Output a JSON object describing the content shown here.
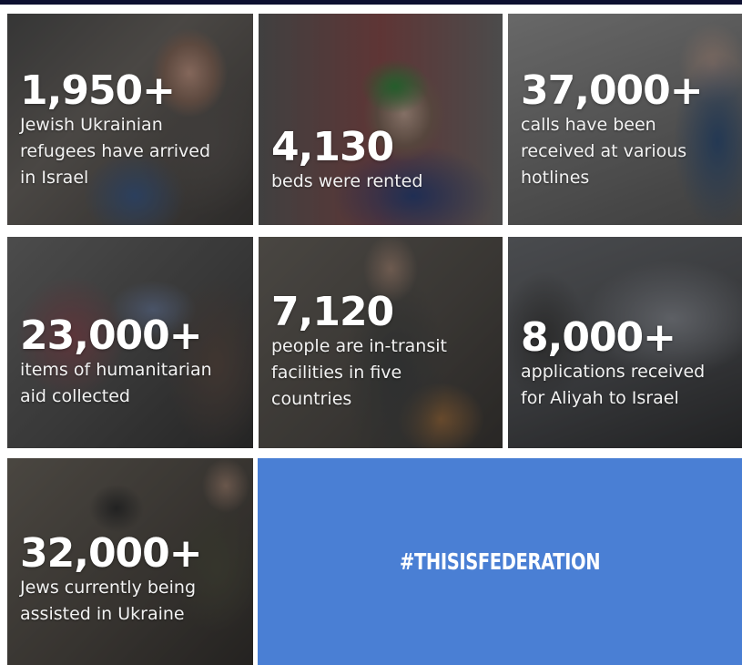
{
  "stats": [
    {
      "number": "1,950+",
      "lines": [
        "Jewish Ukrainian",
        "refugees have arrived",
        "in Israel"
      ]
    },
    {
      "number": "4,130",
      "lines": [
        "beds were rented"
      ]
    },
    {
      "number": "37,000+",
      "lines": [
        "calls have been",
        "received at various",
        "hotlines"
      ]
    },
    {
      "number": "23,000+",
      "lines": [
        "items of humanitarian",
        "aid collected"
      ]
    },
    {
      "number": "7,120",
      "lines": [
        "people are in-transit",
        "facilities in five",
        "countries"
      ]
    },
    {
      "number": "8,000+",
      "lines": [
        "applications received",
        "for Aliyah to Israel"
      ]
    },
    {
      "number": "32,000+",
      "lines": [
        "Jews currently being",
        "assisted in Ukraine"
      ]
    }
  ],
  "hashtag": "#THISISFEDERATION",
  "colors": {
    "hashtag_bg": "#4a7fd4",
    "top_bar": "#0d1030",
    "text": "#ffffff"
  }
}
